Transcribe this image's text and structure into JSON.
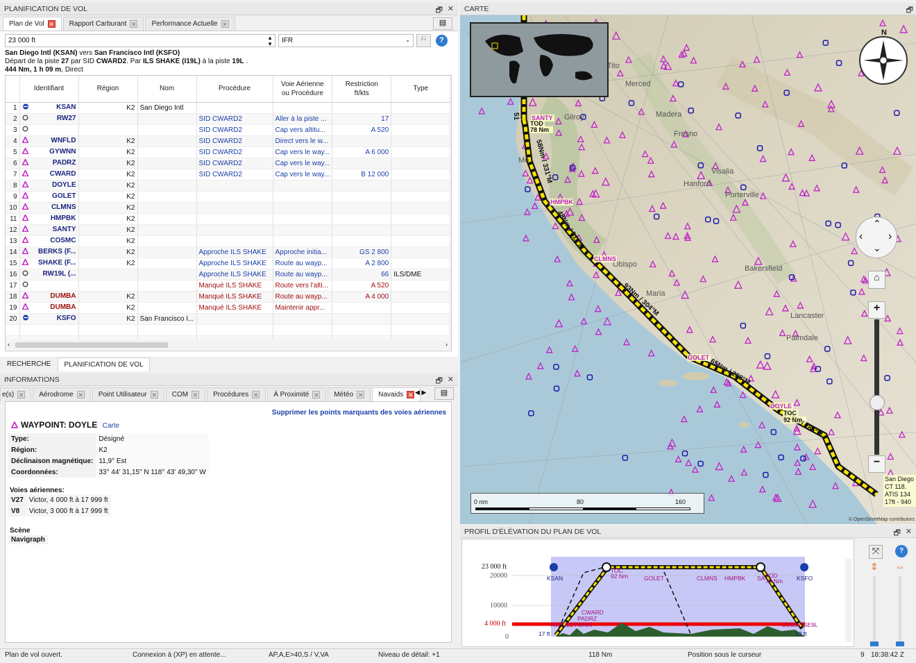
{
  "left_panel": {
    "title": "PLANIFICATION DE VOL",
    "tabs": [
      {
        "label": "Plan de Vol",
        "active": true
      },
      {
        "label": "Rapport Carburant"
      },
      {
        "label": "Performance Actuelle"
      }
    ],
    "altitude": "23 000 ft",
    "flight_rules": "IFR",
    "summary1_a": "San Diego Intl (KSAN)",
    "summary1_b": " vers ",
    "summary1_c": "San Francisco Intl (KSFO)",
    "summary2": "Départ de la piste ",
    "summary2_rwy": "27",
    "summary2_b": " par SID ",
    "summary2_sid": "CWARD2",
    "summary2_c": ". Par ",
    "summary2_app": "ILS SHAKE (I19L)",
    "summary2_d": " à la piste ",
    "summary2_rwy2": "19L",
    "summary2_e": " .",
    "summary3_a": "444 Nm, 1 h 09 m",
    "summary3_b": ", Direct",
    "columns": [
      "",
      "Identifiant",
      "Région",
      "Nom",
      "Procédure",
      "Voie Aérienne\nou Procédure",
      "Restriction\nft/kts",
      "Type"
    ],
    "rows": [
      {
        "n": "1",
        "icon": "airport",
        "id": "KSAN",
        "region": "K2",
        "name": "San Diego Intl",
        "proc": "",
        "via": "",
        "rest": "",
        "type": ""
      },
      {
        "n": "2",
        "icon": "circle",
        "id": "RW27",
        "region": "",
        "name": "",
        "proc": "SID CWARD2",
        "via": "Aller à la piste ...",
        "rest": "17",
        "type": ""
      },
      {
        "n": "3",
        "icon": "circle",
        "id": "",
        "region": "",
        "name": "",
        "proc": "SID CWARD2",
        "via": "Cap vers altitu...",
        "rest": "A 520",
        "type": ""
      },
      {
        "n": "4",
        "icon": "tri",
        "id": "WNFLD",
        "region": "K2",
        "name": "",
        "proc": "SID CWARD2",
        "via": "Direct vers le w...",
        "rest": "",
        "type": ""
      },
      {
        "n": "5",
        "icon": "tri",
        "id": "GYWNN",
        "region": "K2",
        "name": "",
        "proc": "SID CWARD2",
        "via": "Cap vers le way...",
        "rest": "A 6 000",
        "type": ""
      },
      {
        "n": "6",
        "icon": "tri",
        "id": "PADRZ",
        "region": "K2",
        "name": "",
        "proc": "SID CWARD2",
        "via": "Cap vers le way...",
        "rest": "",
        "type": ""
      },
      {
        "n": "7",
        "icon": "tri",
        "id": "CWARD",
        "region": "K2",
        "name": "",
        "proc": "SID CWARD2",
        "via": "Cap vers le way...",
        "rest": "B 12 000",
        "type": ""
      },
      {
        "n": "8",
        "icon": "tri",
        "id": "DOYLE",
        "region": "K2",
        "name": "",
        "proc": "",
        "via": "",
        "rest": "",
        "type": ""
      },
      {
        "n": "9",
        "icon": "tri",
        "id": "GOLET",
        "region": "K2",
        "name": "",
        "proc": "",
        "via": "",
        "rest": "",
        "type": ""
      },
      {
        "n": "10",
        "icon": "tri",
        "id": "CLMNS",
        "region": "K2",
        "name": "",
        "proc": "",
        "via": "",
        "rest": "",
        "type": ""
      },
      {
        "n": "11",
        "icon": "tri",
        "id": "HMPBK",
        "region": "K2",
        "name": "",
        "proc": "",
        "via": "",
        "rest": "",
        "type": ""
      },
      {
        "n": "12",
        "icon": "tri",
        "id": "SANTY",
        "region": "K2",
        "name": "",
        "proc": "",
        "via": "",
        "rest": "",
        "type": ""
      },
      {
        "n": "13",
        "icon": "tri",
        "id": "COSMC",
        "region": "K2",
        "name": "",
        "proc": "",
        "via": "",
        "rest": "",
        "type": ""
      },
      {
        "n": "14",
        "icon": "tri",
        "id": "BERKS (F...",
        "region": "K2",
        "name": "",
        "proc": "Approche ILS SHAKE",
        "via": "Approche initia...",
        "rest": "GS 2 800",
        "type": ""
      },
      {
        "n": "15",
        "icon": "tri",
        "id": "SHAKE (F...",
        "region": "K2",
        "name": "",
        "proc": "Approche ILS SHAKE",
        "via": "Route au wayp...",
        "rest": "A 2 800",
        "type": ""
      },
      {
        "n": "16",
        "icon": "circle",
        "id": "RW19L (...",
        "region": "",
        "name": "",
        "proc": "Approche ILS SHAKE",
        "via": "Route au wayp...",
        "rest": "66",
        "type": "ILS/DME"
      },
      {
        "n": "17",
        "icon": "circle",
        "id": "",
        "region": "",
        "name": "",
        "proc": "Manqué ILS SHAKE",
        "via": "Route vers l'alti...",
        "rest": "A 520",
        "type": "",
        "miss": true
      },
      {
        "n": "18",
        "icon": "tri",
        "id": "DUMBA",
        "region": "K2",
        "name": "",
        "proc": "Manqué ILS SHAKE",
        "via": "Route au wayp...",
        "rest": "A 4 000",
        "type": "",
        "miss": true
      },
      {
        "n": "19",
        "icon": "tri",
        "id": "DUMBA",
        "region": "K2",
        "name": "",
        "proc": "Manqué ILS SHAKE",
        "via": "Maintenir appr...",
        "rest": "",
        "type": "",
        "miss": true
      },
      {
        "n": "20",
        "icon": "airport",
        "id": "KSFO",
        "region": "K2",
        "name": "San Francisco I...",
        "proc": "",
        "via": "",
        "rest": "",
        "type": ""
      }
    ],
    "bottom_tabs": [
      "RECHERCHE",
      "PLANIFICATION DE VOL"
    ]
  },
  "info_panel": {
    "title": "INFORMATIONS",
    "tabs": [
      "e(s)",
      "Aérodrome",
      "Point Utilisateur",
      "COM",
      "Procédures",
      "À Proximité",
      "Météo",
      "Navaids"
    ],
    "remove_link": "Supprimer les points marquants des voies aériennes",
    "waypoint_title": "WAYPOINT: DOYLE",
    "carte_link": "Carte",
    "props": [
      {
        "k": "Type:",
        "v": "Désigné"
      },
      {
        "k": "Région:",
        "v": "K2"
      },
      {
        "k": "Déclinaison magnétique:",
        "v": "11,9° Est"
      },
      {
        "k": "Coordonnées:",
        "v": "33° 44' 31,15\" N 118° 43' 49,30\" W"
      }
    ],
    "airways_title": "Voies aériennes:",
    "airways": [
      {
        "k": "V27",
        "v": "Victor, 4 000 ft à 17 999 ft"
      },
      {
        "k": "V8",
        "v": "Victor, 3 000 ft à 17 999 ft"
      }
    ],
    "scene_title": "Scène",
    "scene_value": "Navigraph"
  },
  "map_panel": {
    "title": "CARTE",
    "city_labels": [
      "Merced",
      "Madera",
      "Fresno",
      "Hanford",
      "Visalia",
      "Porterville",
      "Bakersfield",
      "Lancaster",
      "Palmdale",
      "Obispo",
      "Maria",
      "Gilroy",
      "Mo",
      "Tito"
    ],
    "route_labels": [
      "SANTY",
      "TOD",
      "78 Nm",
      "HMPBK",
      "CLMNS",
      "GOLET",
      "DOYLE",
      "TOC",
      "92 Nm"
    ],
    "leg_labels": [
      "58Nm / 331°M",
      "48Nm / 311°M",
      "93Nm / 304°M",
      "65Nm / 288°M",
      "/ 286°M",
      "51"
    ],
    "airport_label": [
      "San Diego",
      "CT 118.",
      "ATIS 134",
      "17ft - 940"
    ],
    "scale": [
      "0 nm",
      "80",
      "160"
    ],
    "attribution": "© OpenStreetMap contributors",
    "compass_n": "N"
  },
  "profile_panel": {
    "title": "PROFIL D'ÉLÉVATION DU PLAN DE VOL",
    "alt_labels": [
      "23 000 ft",
      "20000",
      "10000",
      "4 000 ft",
      "0"
    ],
    "point_labels": [
      "KSAN",
      "TOC",
      "92 Nm",
      "GOLET",
      "CLMNS",
      "HMPBK",
      "SA",
      "TOD",
      "78 Nm",
      "KSFO",
      "CWARD",
      "PADRZ",
      "RW27",
      "LDYWNN",
      "COSMCSE9L",
      "17 ft",
      "13 ft"
    ]
  },
  "status": {
    "s1": "Plan de vol ouvert.",
    "s2": "Connexion à (XP) en attente...",
    "s3": "AP,A,E>40,S / V,VA",
    "s4": "Niveau de détail: +1",
    "s5": "118 Nm",
    "s6": "Position sous le curseur",
    "s7": "9",
    "s8": "18:38:42 Z"
  },
  "colors": {
    "accent_blue": "#1a3ea8",
    "missed_red": "#a01010",
    "route_yellow": "#f6e200",
    "waypoint_magenta": "#c022c8"
  }
}
